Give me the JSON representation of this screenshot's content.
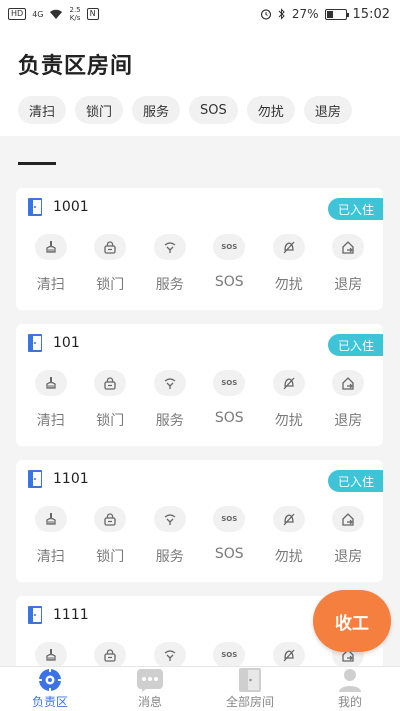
{
  "status_bar": {
    "hd": "HD",
    "network": "4G",
    "speed_value": "2.5",
    "speed_unit": "K/s",
    "nfc": "N",
    "battery": "27%",
    "time": "15:02"
  },
  "header": {
    "title": "负责区房间",
    "filters": [
      "清扫",
      "锁门",
      "服务",
      "SOS",
      "勿扰",
      "退房"
    ]
  },
  "section": {
    "label": "——"
  },
  "rooms": [
    {
      "number": "1001",
      "status": "已入住"
    },
    {
      "number": "101",
      "status": "已入住"
    },
    {
      "number": "1101",
      "status": "已入住"
    },
    {
      "number": "1111",
      "status": ""
    }
  ],
  "actions": [
    {
      "label": "清扫",
      "icon": "sweep-icon"
    },
    {
      "label": "锁门",
      "icon": "lock-icon"
    },
    {
      "label": "服务",
      "icon": "service-icon"
    },
    {
      "label": "SOS",
      "icon": "sos-icon",
      "icon_text": "SOS"
    },
    {
      "label": "勿扰",
      "icon": "do-not-disturb-icon"
    },
    {
      "label": "退房",
      "icon": "checkout-icon"
    }
  ],
  "fab": {
    "label": "收工"
  },
  "bottom_nav": [
    {
      "label": "负责区",
      "icon": "target-icon",
      "active": true
    },
    {
      "label": "消息",
      "icon": "message-icon",
      "active": false
    },
    {
      "label": "全部房间",
      "icon": "door-icon",
      "active": false
    },
    {
      "label": "我的",
      "icon": "user-icon",
      "active": false
    }
  ],
  "colors": {
    "accent": "#3b73e6",
    "badge": "#3fc3d6",
    "fab": "#f57f3f",
    "background": "#f4f4f4"
  }
}
